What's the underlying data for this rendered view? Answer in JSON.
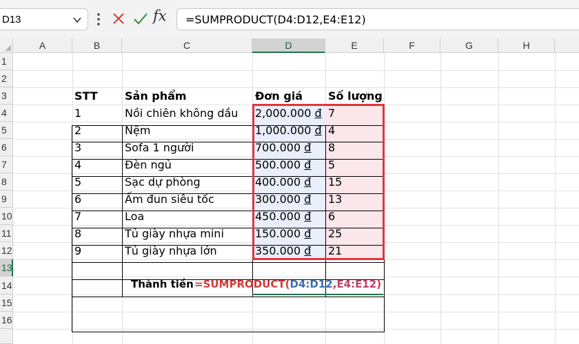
{
  "formula_bar": {
    "name_box": "D13",
    "cancel_icon": "x-icon",
    "enter_icon": "check-icon",
    "fx_label": "fx",
    "formula": "=SUMPRODUCT(D4:D12,E4:E12)"
  },
  "columns": [
    "A",
    "B",
    "C",
    "D",
    "E",
    "F",
    "G",
    "H"
  ],
  "rows": [
    "1",
    "2",
    "3",
    "4",
    "5",
    "6",
    "7",
    "8",
    "9",
    "10",
    "11",
    "12",
    "13",
    "14",
    "15",
    "16"
  ],
  "table": {
    "headers": {
      "stt": "STT",
      "product": "Sản phẩm",
      "price": "Đơn giá",
      "qty": "Số lượng"
    },
    "items": [
      {
        "stt": "1",
        "product": "Nồi chiên không dầu",
        "price": "2,000.000",
        "qty": "7"
      },
      {
        "stt": "2",
        "product": "Nệm",
        "price": "1,000.000",
        "qty": "4"
      },
      {
        "stt": "3",
        "product": "Sofa 1 người",
        "price": "700.000",
        "qty": "8"
      },
      {
        "stt": "4",
        "product": "Đèn ngủ",
        "price": "500.000",
        "qty": "5"
      },
      {
        "stt": "5",
        "product": "Sạc dự phòng",
        "price": "400.000",
        "qty": "15"
      },
      {
        "stt": "6",
        "product": "Ấm đun siêu tốc",
        "price": "300.000",
        "qty": "13"
      },
      {
        "stt": "7",
        "product": "Loa",
        "price": "450.000",
        "qty": "6"
      },
      {
        "stt": "8",
        "product": "Tủ giày nhựa mini",
        "price": "150.000",
        "qty": "25"
      },
      {
        "stt": "9",
        "product": "Tủ giày nhựa lớn",
        "price": "350.000",
        "qty": "21"
      }
    ],
    "currency": "đ"
  },
  "total": {
    "label": "Thành tiền",
    "formula_prefix": "=SUMPRODUCT(",
    "range1": "D4:D12",
    "comma": ",",
    "range2": "E4:E12",
    "suffix": ")"
  },
  "colors": {
    "highlight_border": "#e0343c",
    "price_fill": "#e8eefa",
    "qty_fill": "#fbe6ea",
    "active": "#1e7145"
  }
}
